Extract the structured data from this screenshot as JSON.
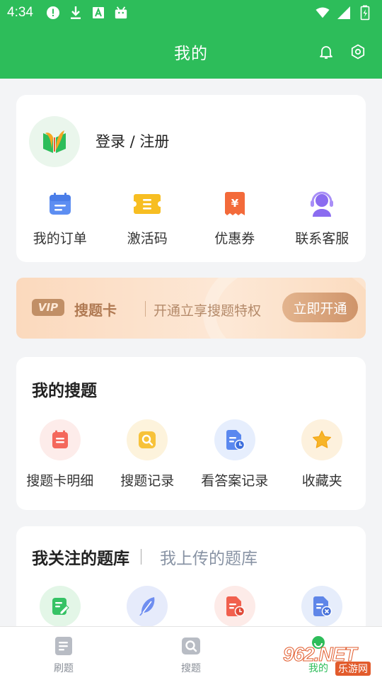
{
  "status": {
    "time": "4:34"
  },
  "header": {
    "title": "我的"
  },
  "profile": {
    "login_text": "登录 / 注册",
    "actions": [
      {
        "label": "我的订单",
        "icon": "calendar-list-icon"
      },
      {
        "label": "激活码",
        "icon": "ticket-icon"
      },
      {
        "label": "优惠券",
        "icon": "coupon-yuan-icon"
      },
      {
        "label": "联系客服",
        "icon": "headset-agent-icon"
      }
    ]
  },
  "vip": {
    "badge": "VIP",
    "name": "搜题卡",
    "desc": "开通立享搜题特权",
    "button": "立即开通"
  },
  "my_search": {
    "title": "我的搜题",
    "items": [
      {
        "label": "搜题卡明细",
        "icon": "card-detail-icon"
      },
      {
        "label": "搜题记录",
        "icon": "search-record-icon"
      },
      {
        "label": "看答案记录",
        "icon": "answer-record-icon"
      },
      {
        "label": "收藏夹",
        "icon": "star-icon"
      }
    ]
  },
  "banks": {
    "tab_following": "我关注的题库",
    "tab_uploaded": "我上传的题库"
  },
  "nav": {
    "items": [
      {
        "label": "刷题"
      },
      {
        "label": "搜题"
      },
      {
        "label": "我的"
      }
    ]
  },
  "watermark": {
    "big": "962.NET",
    "small": "乐游网"
  },
  "colors": {
    "brand_green": "#2dbd5a",
    "vip_brown": "#b07a53"
  }
}
